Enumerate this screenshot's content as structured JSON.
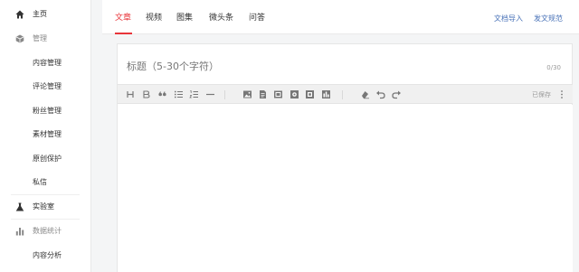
{
  "sidebar": {
    "home": {
      "label": "主页",
      "icon": "home-icon"
    },
    "manage": {
      "label": "管理",
      "icon": "cube-icon"
    },
    "manage_items": [
      {
        "label": "内容管理"
      },
      {
        "label": "评论管理"
      },
      {
        "label": "粉丝管理"
      },
      {
        "label": "素材管理"
      },
      {
        "label": "原创保护"
      },
      {
        "label": "私信"
      }
    ],
    "lab": {
      "label": "实验室",
      "icon": "flask-icon"
    },
    "stats": {
      "label": "数据统计",
      "icon": "bar-chart-icon"
    },
    "stats_items": [
      {
        "label": "内容分析"
      }
    ]
  },
  "tabs": [
    {
      "label": "文章",
      "active": true
    },
    {
      "label": "视频",
      "active": false
    },
    {
      "label": "图集",
      "active": false
    },
    {
      "label": "微头条",
      "active": false
    },
    {
      "label": "问答",
      "active": false
    }
  ],
  "top_links": {
    "import": "文档导入",
    "guidelines": "发文规范"
  },
  "editor": {
    "title_placeholder": "标题（5-30个字符）",
    "title_value": "",
    "char_count": "0/30",
    "save_status": "已保存",
    "toolbar": [
      "heading-icon",
      "bold-icon",
      "quote-icon",
      "bullet-list-icon",
      "numbered-list-icon",
      "divider-icon",
      "image-icon",
      "document-icon",
      "video-icon",
      "audio-icon",
      "poll-icon",
      "gallery-icon",
      "clear-format-icon",
      "undo-icon",
      "redo-icon"
    ]
  },
  "colors": {
    "accent": "#e8353a",
    "link": "#4a73b8",
    "page_bg": "#f4f5f6"
  }
}
